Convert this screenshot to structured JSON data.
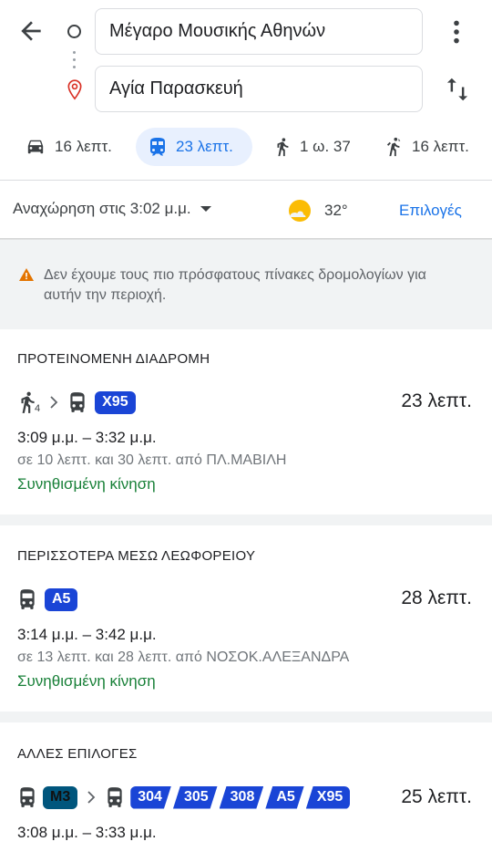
{
  "search": {
    "origin": "Μέγαρο Μουσικής Αθηνών",
    "destination": "Αγία Παρασκευή"
  },
  "modes": [
    {
      "icon": "car-icon",
      "label": "16 λεπτ.",
      "selected": false
    },
    {
      "icon": "transit-icon",
      "label": "23 λεπτ.",
      "selected": true
    },
    {
      "icon": "walk-icon",
      "label": "1 ω. 37",
      "selected": false
    },
    {
      "icon": "ride-icon",
      "label": "16 λεπτ.",
      "selected": false
    }
  ],
  "depart": {
    "label": "Αναχώρηση στις 3:02 μ.μ.",
    "weather_icon": "partly-sunny-icon",
    "temperature": "32°",
    "options_label": "Επιλογές"
  },
  "warning": {
    "icon": "warning-icon",
    "text": "Δεν έχουμε τους πιο πρόσφατους πίνακες δρομολογίων για αυτήν την περιοχή."
  },
  "routes": [
    {
      "section_title": "ΠΡΟΤΕΙΝΟΜΕΝΗ ΔΙΑΔΡΟΜΗ",
      "walk_minutes": "4",
      "lines": [
        "X95"
      ],
      "duration": "23 λεπτ.",
      "times": "3:09 μ.μ. – 3:32 μ.μ.",
      "frequency": "σε 10 λεπτ. και 30 λεπτ. από ΠΛ.ΜΑΒΙΛΗ",
      "traffic": "Συνηθισμένη κίνηση"
    },
    {
      "section_title": "ΠΕΡΙΣΣΟΤΕΡΑ ΜΕΣΩ ΛΕΩΦΟΡΕΙΟΥ",
      "lines": [
        "A5"
      ],
      "duration": "28 λεπτ.",
      "times": "3:14 μ.μ. – 3:42 μ.μ.",
      "frequency": "σε 13 λεπτ. και 28 λεπτ. από ΝΟΣΟΚ.ΑΛΕΞΑΝΔΡΑ",
      "traffic": "Συνηθισμένη κίνηση"
    },
    {
      "section_title": "ΑΛΛΕΣ ΕΠΙΛΟΓΕΣ",
      "first_line": "M3",
      "lines": [
        "304",
        "305",
        "308",
        "A5",
        "X95"
      ],
      "duration": "25 λεπτ.",
      "times": "3:08 μ.μ. – 3:33 μ.μ."
    }
  ],
  "colors": {
    "accent": "#1a73e8",
    "bus_badge": "#1a45d6",
    "metro_badge": "#00567d",
    "traffic_green": "#188038",
    "warning_orange": "#e37400"
  }
}
